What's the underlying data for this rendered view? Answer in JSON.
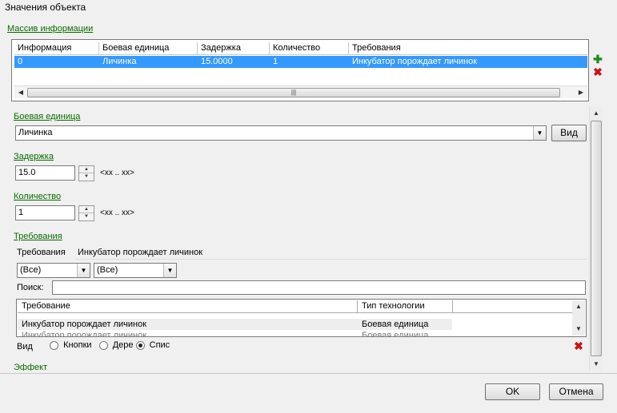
{
  "window": {
    "title": "Значения объекта"
  },
  "info_array": {
    "label": "Массив информации",
    "columns": [
      "Информация",
      "Боевая единица",
      "Задержка",
      "Количество",
      "Требования"
    ],
    "rows": [
      [
        "0",
        "Личинка",
        "15.0000",
        "1",
        "Инкубатор порождает личинок"
      ]
    ]
  },
  "unit": {
    "label": "Боевая единица",
    "value": "Личинка",
    "view_button": "Вид"
  },
  "delay": {
    "label": "Задержка",
    "value": "15.0",
    "hint": "<xx .. xx>"
  },
  "quantity": {
    "label": "Количество",
    "value": "1",
    "hint": "<xx .. xx>"
  },
  "requirements": {
    "label": "Требования",
    "field_label": "Требования",
    "field_value": "Инкубатор порождает личинок",
    "filter1": "(Все)",
    "filter2": "(Все)",
    "search_label": "Поиск:",
    "search_value": "",
    "columns": [
      "Требование",
      "Тип технологии"
    ],
    "rows": [
      [
        "Инкубатор порождает личинок",
        "Боевая единица"
      ],
      [
        "Инкубатор порождает личинок",
        "Боевая единица"
      ]
    ]
  },
  "view_mode": {
    "label": "Вид",
    "options": [
      "Кнопки",
      "Дере",
      "Спис"
    ],
    "selected": "Спис"
  },
  "effect": {
    "label": "Эффект"
  },
  "footer": {
    "ok": "OK",
    "cancel": "Отмена"
  },
  "colors": {
    "selection": "#3399ff",
    "link_green": "#0b6b00",
    "delete_red": "#cc1111"
  }
}
